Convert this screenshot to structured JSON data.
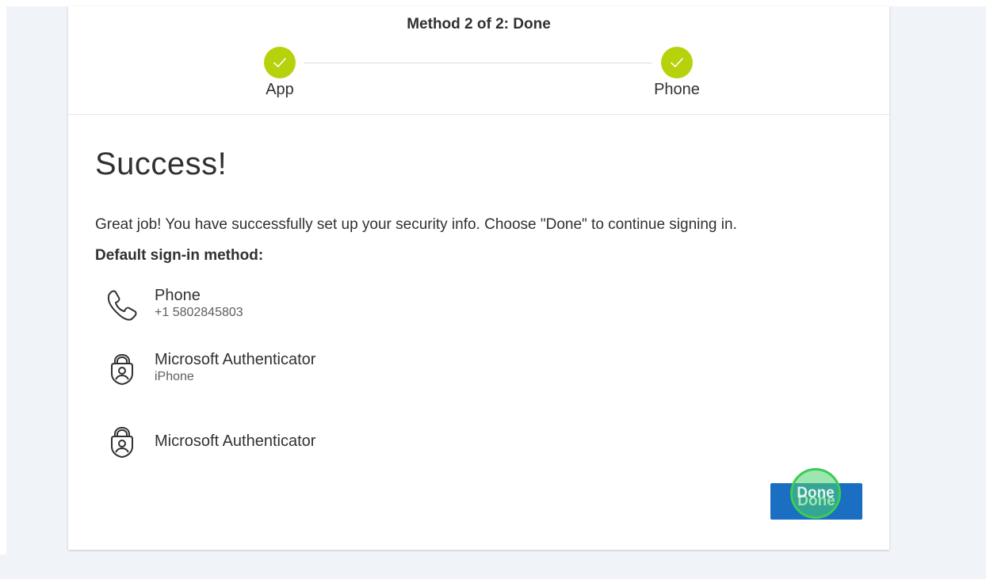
{
  "header": {
    "step_title": "Method 2 of 2: Done",
    "steps": [
      {
        "label": "App",
        "status": "complete"
      },
      {
        "label": "Phone",
        "status": "complete"
      }
    ]
  },
  "main": {
    "title": "Success!",
    "message": "Great job! You have successfully set up your security info. Choose \"Done\" to continue signing in.",
    "default_method_label": "Default sign-in method:",
    "methods": [
      {
        "icon": "phone-icon",
        "name": "Phone",
        "detail": "+1 5802845803"
      },
      {
        "icon": "authenticator-icon",
        "name": "Microsoft Authenticator",
        "detail": "iPhone"
      },
      {
        "icon": "authenticator-icon",
        "name": "Microsoft Authenticator",
        "detail": ""
      }
    ],
    "done_label": "Done"
  },
  "colors": {
    "accent": "#1a6fc3",
    "step_complete": "#b7d20c",
    "page_background": "#f0f3f8",
    "click_indicator": "#3ccc55"
  }
}
